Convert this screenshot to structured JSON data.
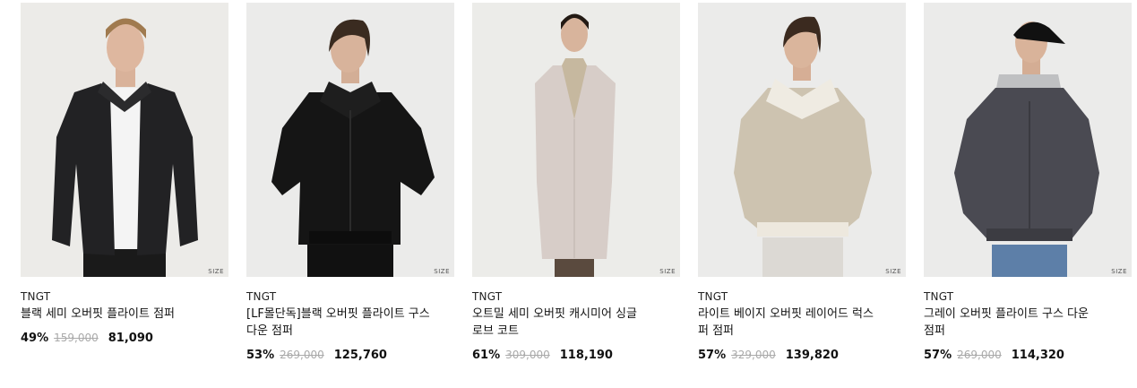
{
  "products": [
    {
      "size_label": "SIZE",
      "brand": "TNGT",
      "name": "블랙 세미 오버핏 플라이트 점퍼",
      "discount": "49%",
      "original_price": "159,000",
      "sale_price": "81,090",
      "jacket_color": "#1f1f20",
      "bg_color": "#ececea"
    },
    {
      "size_label": "SIZE",
      "brand": "TNGT",
      "name": "[LF몰단독]블랙 오버핏 플라이트 구스 다운 점퍼",
      "discount": "53%",
      "original_price": "269,000",
      "sale_price": "125,760",
      "jacket_color": "#141414",
      "bg_color": "#ebebea"
    },
    {
      "size_label": "SIZE",
      "brand": "TNGT",
      "name": "오트밀 세미 오버핏 캐시미어 싱글 로브 코트",
      "discount": "61%",
      "original_price": "309,000",
      "sale_price": "118,190",
      "jacket_color": "#d8cfcb",
      "bg_color": "#ececeb"
    },
    {
      "size_label": "SIZE",
      "brand": "TNGT",
      "name": "라이트 베이지 오버핏 레이어드 럭스 퍼 점퍼",
      "discount": "57%",
      "original_price": "329,000",
      "sale_price": "139,820",
      "jacket_color": "#cdc3b0",
      "bg_color": "#ebebea"
    },
    {
      "size_label": "SIZE",
      "brand": "TNGT",
      "name": "그레이 오버핏 플라이트 구스 다운 점퍼",
      "discount": "57%",
      "original_price": "269,000",
      "sale_price": "114,320",
      "jacket_color": "#4b4b52",
      "bg_color": "#ebebea"
    }
  ]
}
